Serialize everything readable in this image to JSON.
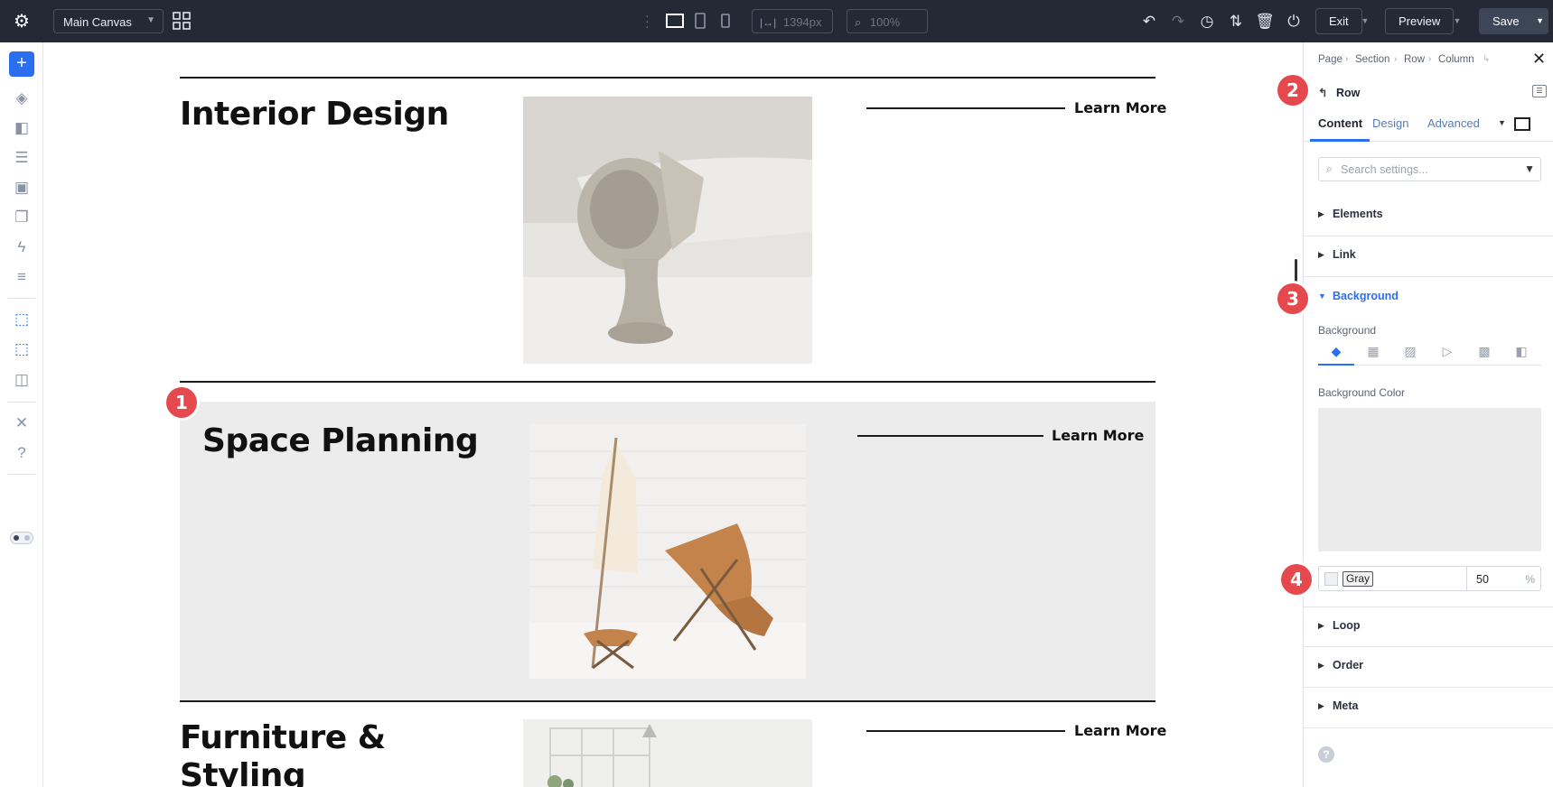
{
  "topbar": {
    "canvas_name": "Main Canvas",
    "width_value": "1394px",
    "zoom_value": "100%",
    "exit_label": "Exit",
    "preview_label": "Preview",
    "save_label": "Save"
  },
  "main": {
    "rows": [
      {
        "title": "Interior Design",
        "link": "Learn More"
      },
      {
        "title": "Space Planning",
        "link": "Learn More"
      },
      {
        "title_line1": "Furniture &",
        "title_line2": "Styling",
        "link": "Learn More"
      }
    ],
    "markers": [
      "1",
      "2",
      "3",
      "4"
    ]
  },
  "panel": {
    "breadcrumb": [
      "Page",
      "Section",
      "Row",
      "Column"
    ],
    "element_name": "Row",
    "tabs": [
      "Content",
      "Design",
      "Advanced"
    ],
    "active_tab": "Content",
    "search_placeholder": "Search settings...",
    "sections_top": [
      "Elements",
      "Link"
    ],
    "background_section": "Background",
    "background_sub": "Background",
    "background_color_label": "Background Color",
    "color_name": "Gray",
    "opacity_value": "50",
    "opacity_unit": "%",
    "sections_bottom": [
      "Loop",
      "Order",
      "Meta"
    ]
  },
  "colors": {
    "accent": "#2b6ff0",
    "marker": "#e5484d",
    "topbar": "#232a36",
    "row_highlight": "#ececec"
  }
}
